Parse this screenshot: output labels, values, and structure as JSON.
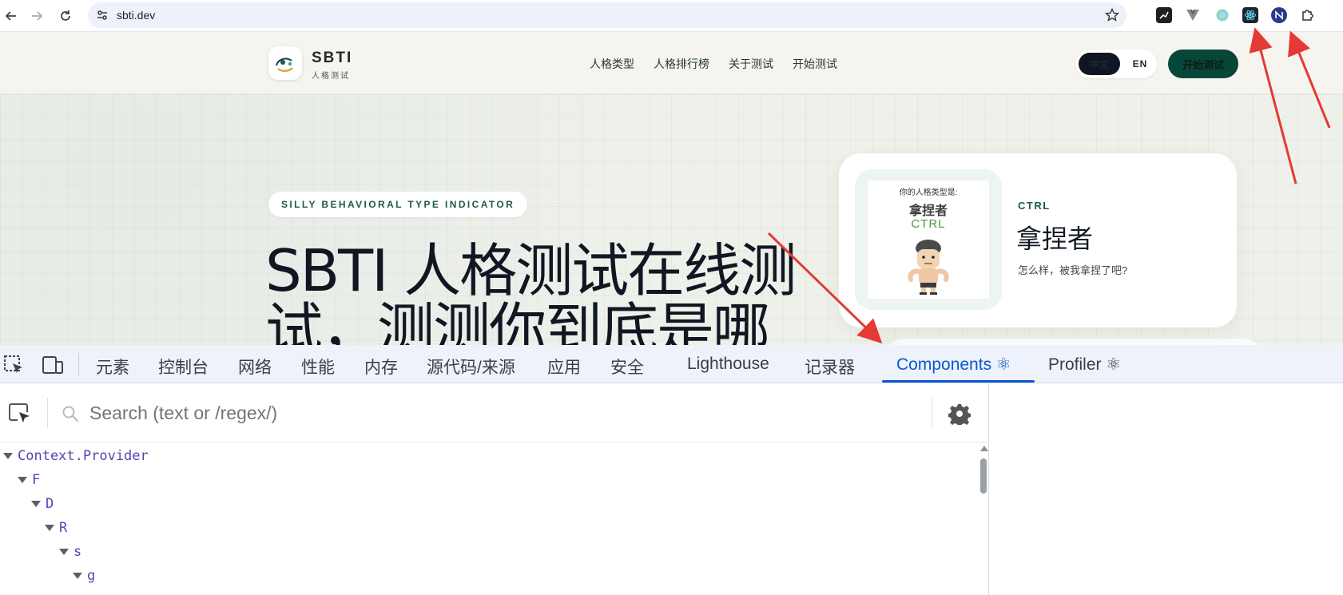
{
  "browser": {
    "url": "sbti.dev"
  },
  "site": {
    "brand": "SBTI",
    "brand_sub": "人格测试",
    "nav": [
      "人格类型",
      "人格排行榜",
      "关于测试",
      "开始测试"
    ],
    "lang_zh": "中文",
    "lang_en": "EN",
    "start_button": "开始测试",
    "tagline": "SILLY BEHAVIORAL TYPE INDICATOR",
    "headline": "SBTI 人格测试在线测试，测测你到底是哪",
    "card": {
      "image_caption": "你的人格类型是:",
      "image_name": "拿捏者",
      "image_code": "CTRL",
      "code": "CTRL",
      "title": "拿捏者",
      "description": "怎么样，被我拿捏了吧?"
    }
  },
  "devtools": {
    "tabs": [
      "元素",
      "控制台",
      "网络",
      "性能",
      "内存",
      "源代码/来源",
      "应用",
      "安全",
      "Lighthouse",
      "记录器",
      "Components ⚛",
      "Profiler ⚛"
    ],
    "active_tab": "Components ⚛",
    "search_placeholder": "Search (text or /regex/)",
    "tree": [
      {
        "label": "Context.Provider",
        "depth": 0
      },
      {
        "label": "F",
        "depth": 1
      },
      {
        "label": "D",
        "depth": 2
      },
      {
        "label": "R",
        "depth": 3
      },
      {
        "label": "s",
        "depth": 4
      },
      {
        "label": "g",
        "depth": 5
      }
    ]
  },
  "colors": {
    "accent_blue": "#0b57d0",
    "brand_green": "#07473a",
    "component_purple": "#5c3fb2",
    "annotation_red": "#e53935"
  }
}
